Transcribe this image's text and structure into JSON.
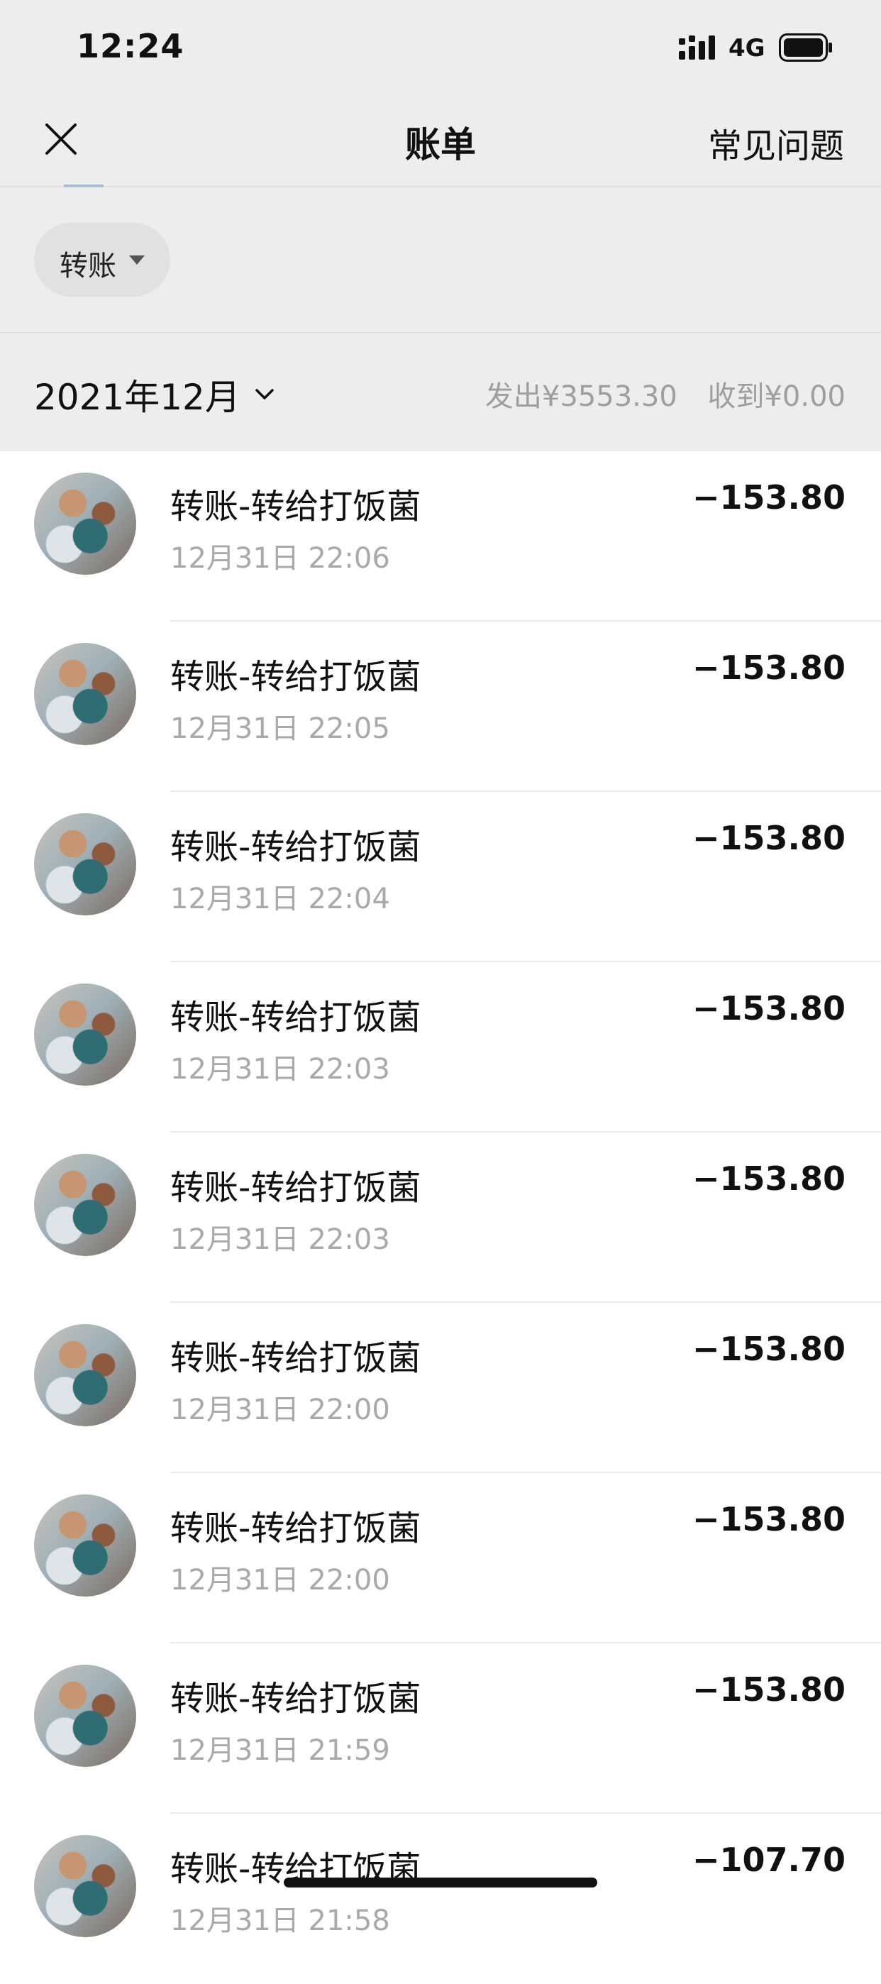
{
  "status_bar": {
    "time": "12:24",
    "network": "4G",
    "icons": [
      "signal-icon",
      "battery-icon"
    ]
  },
  "nav": {
    "title": "账单",
    "right_action": "常见问题",
    "close_icon": "close-icon"
  },
  "filter": {
    "chip_label": "转账",
    "chip_icon": "caret-down-icon"
  },
  "month": {
    "label": "2021年12月",
    "expense_summary": "发出¥3553.30",
    "income_summary": "收到¥0.00"
  },
  "transactions": [
    {
      "title": "转账-转给打饭菌",
      "time": "12月31日 22:06",
      "amount": "−153.80"
    },
    {
      "title": "转账-转给打饭菌",
      "time": "12月31日 22:05",
      "amount": "−153.80"
    },
    {
      "title": "转账-转给打饭菌",
      "time": "12月31日 22:04",
      "amount": "−153.80"
    },
    {
      "title": "转账-转给打饭菌",
      "time": "12月31日 22:03",
      "amount": "−153.80"
    },
    {
      "title": "转账-转给打饭菌",
      "time": "12月31日 22:03",
      "amount": "−153.80"
    },
    {
      "title": "转账-转给打饭菌",
      "time": "12月31日 22:00",
      "amount": "−153.80"
    },
    {
      "title": "转账-转给打饭菌",
      "time": "12月31日 22:00",
      "amount": "−153.80"
    },
    {
      "title": "转账-转给打饭菌",
      "time": "12月31日 21:59",
      "amount": "−153.80"
    },
    {
      "title": "转账-转给打饭菌",
      "time": "12月31日 21:58",
      "amount": "−107.70"
    }
  ],
  "colors": {
    "header_bg": "#ededed",
    "list_bg": "#ffffff",
    "secondary_text": "#a9a9a9"
  }
}
